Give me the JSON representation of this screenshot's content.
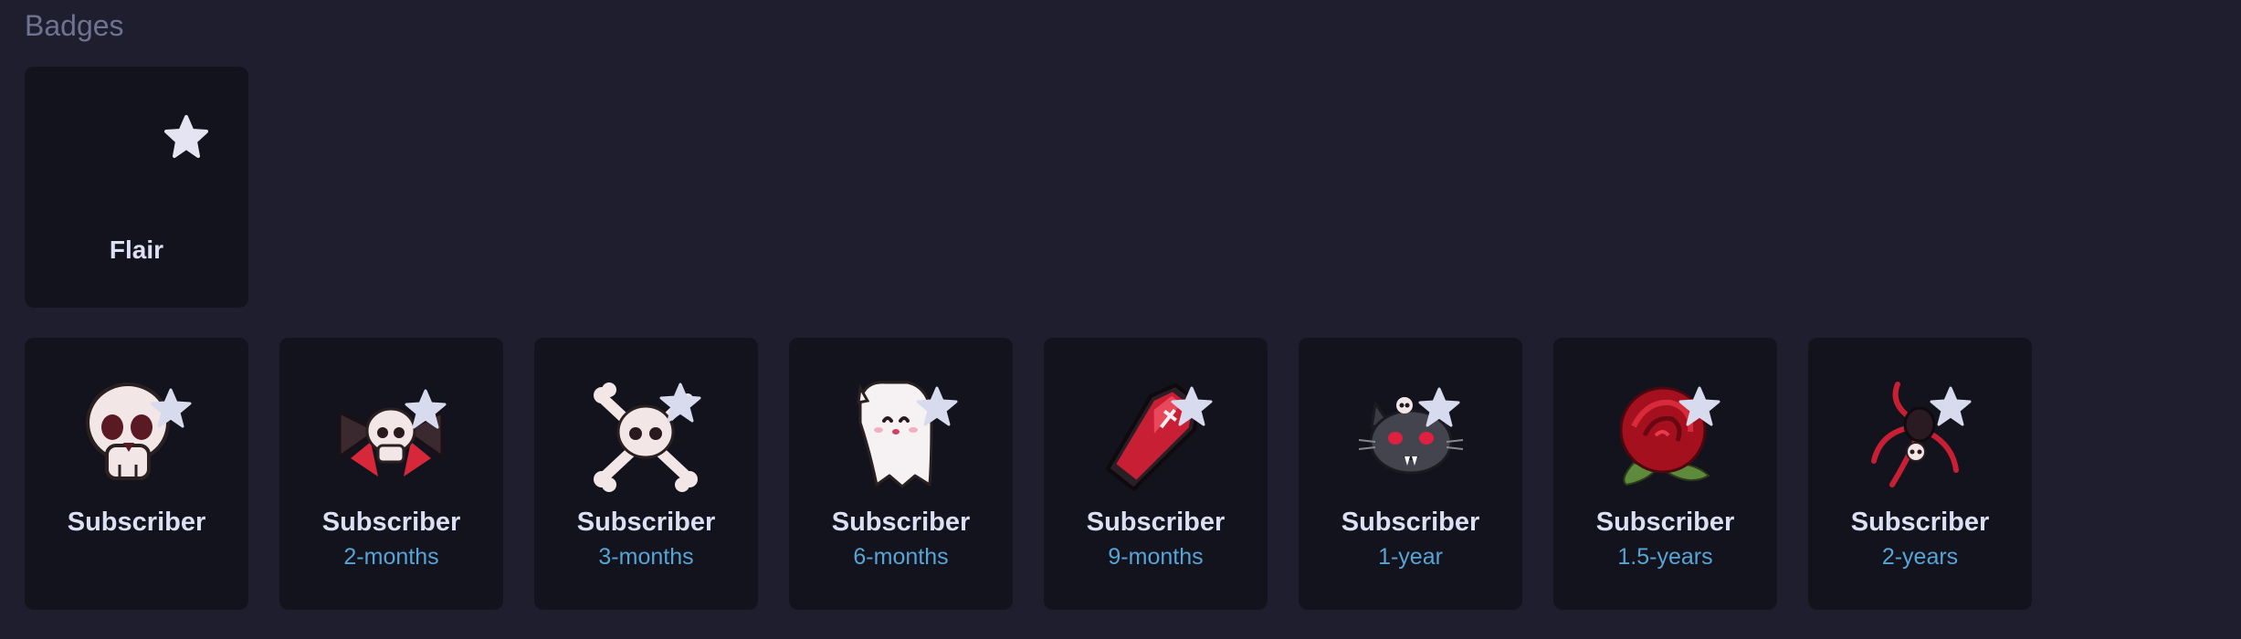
{
  "section": {
    "title": "Badges"
  },
  "flair_badge": {
    "label": "Flair",
    "icon": "star-icon"
  },
  "subscriber_badges": [
    {
      "label": "Subscriber",
      "tier": "",
      "icon": "skull-icon"
    },
    {
      "label": "Subscriber",
      "tier": "2-months",
      "icon": "skull-bow-icon"
    },
    {
      "label": "Subscriber",
      "tier": "3-months",
      "icon": "skull-crossbones-icon"
    },
    {
      "label": "Subscriber",
      "tier": "6-months",
      "icon": "ghost-icon"
    },
    {
      "label": "Subscriber",
      "tier": "9-months",
      "icon": "coffin-icon"
    },
    {
      "label": "Subscriber",
      "tier": "1-year",
      "icon": "vampire-cat-icon"
    },
    {
      "label": "Subscriber",
      "tier": "1.5-years",
      "icon": "rose-icon"
    },
    {
      "label": "Subscriber",
      "tier": "2-years",
      "icon": "spider-icon"
    }
  ],
  "colors": {
    "background": "#1f1e2e",
    "card": "#13131d",
    "label": "#dde0f4",
    "tier": "#57a4d6",
    "section_title": "#6f7290",
    "star": "#e4e4f2"
  }
}
